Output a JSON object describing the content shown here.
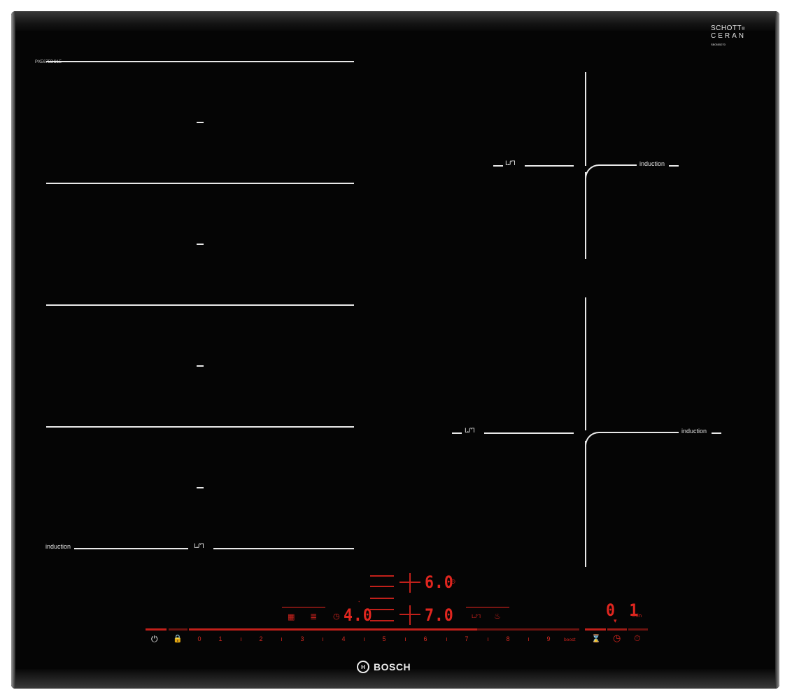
{
  "brand": "BOSCH",
  "brand_mark": "H",
  "glass_brand": {
    "line1": "SCHOTT",
    "line2": "CERAN",
    "reg": "®",
    "code": "SB0555270"
  },
  "model": "PXE675DC1E",
  "zones": {
    "induction_label": "induction",
    "wave_symbol": "ᒪᔑᒣ"
  },
  "displays": {
    "zone_top_level": "6.0",
    "zone_bottom_level": "7.0",
    "left_level": "4.0",
    "timer_value": "0 1",
    "timer_unit": "min",
    "timer_caret": "▾",
    "small_marker": "ᐩ"
  },
  "controls": {
    "power_icon": "⏻",
    "child_lock_icon": "🔒",
    "slider_values": [
      "0",
      "1",
      "2",
      "3",
      "4",
      "5",
      "6",
      "7",
      "8",
      "9"
    ],
    "boost_label": "boost",
    "hourglass_icon": "⌛",
    "clock_icon": "◷",
    "stopwatch_icon": "⏱",
    "frying_icon": "▦",
    "menu_icon": "≣",
    "zone_timer_icon": "◷",
    "top_timer_icon": "◷",
    "wave_mini": "ᒪᔑᒣ",
    "pot_icon": "♨"
  },
  "colors": {
    "glass": "#050505",
    "accent_red": "#e0261f",
    "line": "#e9e9e9"
  }
}
